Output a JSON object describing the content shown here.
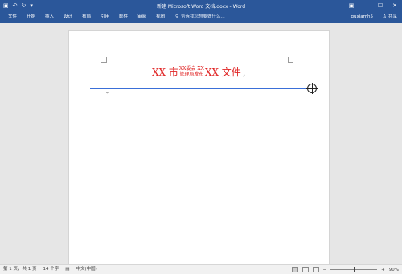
{
  "window": {
    "title": "新建 Microsoft Word 文档.docx - Word",
    "qat_icons": [
      "save-icon",
      "undo-icon",
      "redo-icon",
      "customize-qat-icon"
    ],
    "controls": {
      "ribbon_options": "▣",
      "minimize": "—",
      "maximize": "☐",
      "close": "✕"
    }
  },
  "ribbon": {
    "tabs": [
      "文件",
      "开始",
      "插入",
      "设计",
      "布局",
      "引用",
      "邮件",
      "审阅",
      "视图"
    ],
    "tell_me": "告诉我您想要做什么...",
    "user": "quxiamh5",
    "share": "共享"
  },
  "document": {
    "heading_prefix": "XX 市",
    "heading_stack_top": "XX委会 XX",
    "heading_stack_bottom": "管理局发布",
    "heading_suffix": "XX 文件",
    "para_mark": "↵"
  },
  "status": {
    "page": "第 1 页，共 1 页",
    "words": "14 个字",
    "language": "中文(中国)",
    "zoom_label": "90%",
    "zoom_fraction": 0.5
  },
  "colors": {
    "accent": "#2b579a",
    "heading_red": "#e02424",
    "divider_blue": "#3a6fd8"
  }
}
